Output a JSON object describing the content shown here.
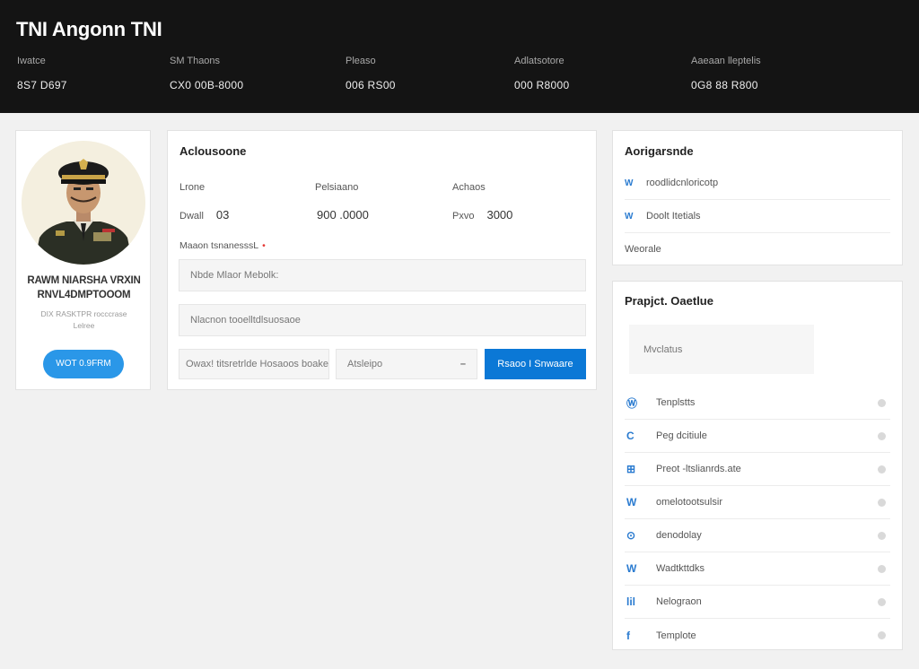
{
  "header": {
    "title": "TNI Angonn TNI",
    "stats": [
      {
        "label": "Iwatce",
        "value": "8S7 D697"
      },
      {
        "label": "SM Thaons",
        "value": "CX0 00B-8000"
      },
      {
        "label": "Pleaso",
        "value": "006 RS00"
      },
      {
        "label": "Adlatsotore",
        "value": "000 R8000"
      },
      {
        "label": "Aaeaan lleptelis",
        "value": "0G8 88 R800"
      }
    ]
  },
  "profile": {
    "name_line1": "RAWM NIARSHA VRXIN",
    "name_line2": "RNVL4DMPTOOOM",
    "meta_line1": "DIX RASKTPR rocccrase",
    "meta_line2": "Lelree",
    "button_label": "WOT 0.9FRM"
  },
  "main": {
    "title": "Aclousoone",
    "columns": [
      {
        "label": "Lrone",
        "sub": "Dwall",
        "value": "03"
      },
      {
        "label": "Pelsiaano",
        "sub": "",
        "value": "900 .0000"
      },
      {
        "label": "Achaos",
        "sub": "Pxvo",
        "value": "3000"
      }
    ],
    "required_label": "Maaon tsnanesssL",
    "input1_placeholder": "Nbde Mlaor Mebolk:",
    "input2_placeholder": "Nlacnon tooelltdlsuosaoe",
    "input3_value": "Owax! titsretrlde Hosaoos boake",
    "select_value": "Atsleipo",
    "submit_label": "Rsaoo I Snwaare"
  },
  "right_top": {
    "title": "Aorigarsnde",
    "rows": [
      {
        "icon": "W",
        "label": "roodlidcnloricotp"
      },
      {
        "icon": "W",
        "label": "Doolt Itetials"
      },
      {
        "icon": "",
        "label": "Weorale"
      }
    ]
  },
  "right_bottom": {
    "title": "Prapjct. Oaetlue",
    "search_placeholder": "Mvclatus",
    "items": [
      {
        "icon": "Ⓦ",
        "label": "Tenplstts"
      },
      {
        "icon": "C",
        "label": "Peg dcitiule"
      },
      {
        "icon": "⊞",
        "label": "Preot -ltslianrds.ate"
      },
      {
        "icon": "W",
        "label": "omelotootsulsir"
      },
      {
        "icon": "⊙",
        "label": "denodolay"
      },
      {
        "icon": "W",
        "label": "Wadtkttdks"
      },
      {
        "icon": "lil",
        "label": "Nelograon"
      },
      {
        "icon": "f",
        "label": "Templote"
      }
    ]
  }
}
